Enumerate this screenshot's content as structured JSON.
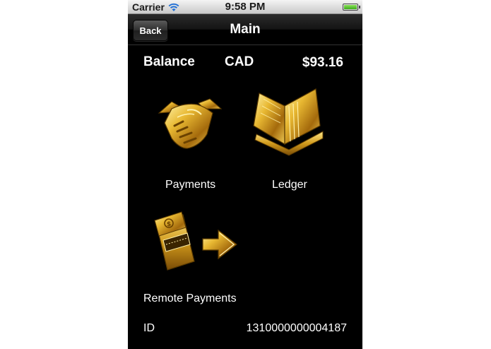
{
  "status_bar": {
    "carrier": "Carrier",
    "time": "9:58 PM",
    "wifi_icon": "wifi-icon",
    "battery_icon": "battery-icon"
  },
  "nav": {
    "back_label": "Back",
    "title": "Main"
  },
  "balance": {
    "label": "Balance",
    "currency": "CAD",
    "amount": "$93.16"
  },
  "tiles": [
    {
      "label": "Payments",
      "icon": "handshake-icon"
    },
    {
      "label": "Ledger",
      "icon": "open-book-icon"
    },
    {
      "label": "Remote Payments",
      "icon": "money-transfer-icon"
    }
  ],
  "account": {
    "id_label": "ID",
    "id_value": "1310000000004187"
  },
  "colors": {
    "background": "#000000",
    "gold": "#d4a017",
    "text": "#ffffff"
  }
}
